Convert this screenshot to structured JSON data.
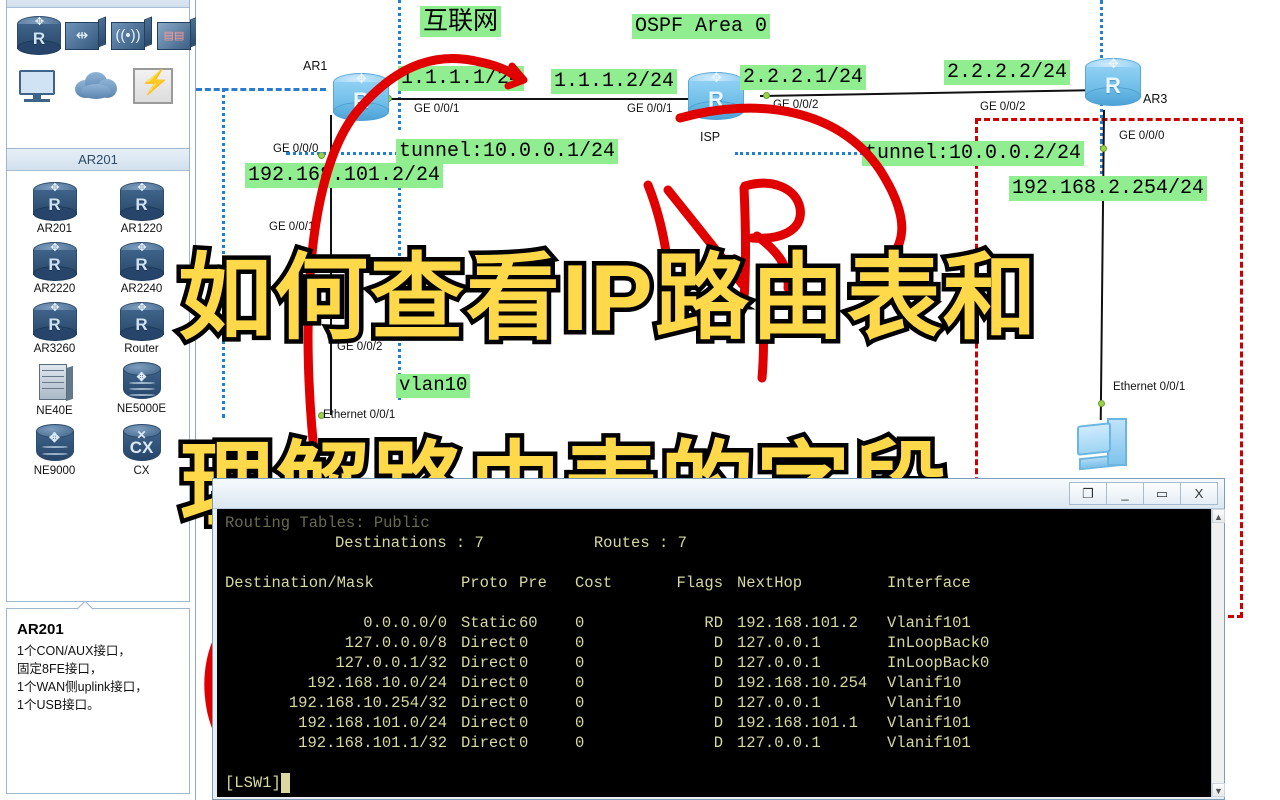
{
  "palette": {
    "top_group": {
      "icons": [
        {
          "name": "router-icon",
          "glyph": "R"
        },
        {
          "name": "switch-icon",
          "glyph": "⇄"
        },
        {
          "name": "wireless-ac-icon",
          "glyph": "((•))"
        },
        {
          "name": "firewall-icon",
          "glyph": "▦"
        },
        {
          "name": "pc-icon",
          "glyph": ""
        },
        {
          "name": "cloud-icon",
          "glyph": ""
        },
        {
          "name": "frame-relay-icon",
          "glyph": "⚡"
        }
      ]
    },
    "selected_group_title": "AR201",
    "devices": [
      {
        "label": "AR201",
        "type": "router"
      },
      {
        "label": "AR1220",
        "type": "router"
      },
      {
        "label": "AR2220",
        "type": "router"
      },
      {
        "label": "AR2240",
        "type": "router"
      },
      {
        "label": "AR3260",
        "type": "router"
      },
      {
        "label": "Router",
        "type": "router"
      },
      {
        "label": "NE40E",
        "type": "chassis"
      },
      {
        "label": "NE5000E",
        "type": "cylinder"
      },
      {
        "label": "NE9000",
        "type": "cylinder"
      },
      {
        "label": "CX",
        "type": "cx"
      }
    ],
    "info": {
      "title": "AR201",
      "lines": [
        "1个CON/AUX接口，",
        "固定8FE接口，",
        "1个WAN侧uplink接口，",
        "1个USB接口。"
      ]
    }
  },
  "topology": {
    "nodes": [
      {
        "name": "AR1",
        "label": "AR1"
      },
      {
        "name": "ISP",
        "label": "ISP"
      },
      {
        "name": "AR3",
        "label": "AR3"
      }
    ],
    "green_labels": [
      {
        "name": "internet-label",
        "text": "互联网"
      },
      {
        "name": "ospf-area-label",
        "text": "OSPF Area 0"
      },
      {
        "name": "ip-1-1-1-1",
        "text": "1.1.1.1/24"
      },
      {
        "name": "ip-1-1-1-2",
        "text": "1.1.1.2/24"
      },
      {
        "name": "ip-2-2-2-1",
        "text": "2.2.2.1/24"
      },
      {
        "name": "ip-2-2-2-2",
        "text": "2.2.2.2/24"
      },
      {
        "name": "tunnel-left",
        "text": "tunnel:10.0.0.1/24"
      },
      {
        "name": "tunnel-right",
        "text": "tunnel:10.0.0.2/24"
      },
      {
        "name": "ip-192-168-101-2",
        "text": "192.168.101.2/24"
      },
      {
        "name": "ip-192-168-2-254",
        "text": "192.168.2.254/24"
      },
      {
        "name": "vlan10-label",
        "text": "vlan10"
      }
    ],
    "interface_labels": [
      {
        "name": "if-ar1-ge001",
        "text": "GE 0/0/1"
      },
      {
        "name": "if-ar1-ge000",
        "text": "GE 0/0/0"
      },
      {
        "name": "if-isp-ge001",
        "text": "GE 0/0/1"
      },
      {
        "name": "if-isp-ge002",
        "text": "GE 0/0/2"
      },
      {
        "name": "if-ar3-ge002",
        "text": "GE 0/0/2"
      },
      {
        "name": "if-ar3-ge000",
        "text": "GE 0/0/0"
      },
      {
        "name": "if-sw-ge001",
        "text": "GE 0/0/1"
      },
      {
        "name": "if-sw-ge002",
        "text": "GE 0/0/2"
      },
      {
        "name": "if-sw-eth001",
        "text": "Ethernet 0/0/1"
      },
      {
        "name": "if-pc-eth001",
        "text": "Ethernet 0/0/1"
      }
    ]
  },
  "overlay_title": {
    "line1": "如何查看IP路由表和",
    "line2": "理解路由表的字段",
    "fill_color": "#ffd94a",
    "stroke_color": "#000000"
  },
  "terminal": {
    "titlebar_buttons": [
      {
        "name": "restore-button",
        "label": "❐"
      },
      {
        "name": "minimize-button",
        "label": "_"
      },
      {
        "name": "maximize-button",
        "label": "▭"
      },
      {
        "name": "close-button",
        "label": "X"
      }
    ],
    "summary": {
      "destinations_label": "Destinations",
      "destinations_value": "7",
      "routes_label": "Routes",
      "routes_value": "7"
    },
    "headers": {
      "destination": "Destination/Mask",
      "proto": "Proto",
      "pre": "Pre",
      "cost": "Cost",
      "flags": "Flags",
      "nexthop": "NextHop",
      "interface": "Interface"
    },
    "routes": [
      {
        "dest": "0.0.0.0/0",
        "proto": "Static",
        "pre": "60",
        "cost": "0",
        "flags": "RD",
        "nexthop": "192.168.101.2",
        "interface": "Vlanif101"
      },
      {
        "dest": "127.0.0.0/8",
        "proto": "Direct",
        "pre": "0",
        "cost": "0",
        "flags": "D",
        "nexthop": "127.0.0.1",
        "interface": "InLoopBack0"
      },
      {
        "dest": "127.0.0.1/32",
        "proto": "Direct",
        "pre": "0",
        "cost": "0",
        "flags": "D",
        "nexthop": "127.0.0.1",
        "interface": "InLoopBack0"
      },
      {
        "dest": "192.168.10.0/24",
        "proto": "Direct",
        "pre": "0",
        "cost": "0",
        "flags": "D",
        "nexthop": "192.168.10.254",
        "interface": "Vlanif10"
      },
      {
        "dest": "192.168.10.254/32",
        "proto": "Direct",
        "pre": "0",
        "cost": "0",
        "flags": "D",
        "nexthop": "127.0.0.1",
        "interface": "Vlanif10"
      },
      {
        "dest": "192.168.101.0/24",
        "proto": "Direct",
        "pre": "0",
        "cost": "0",
        "flags": "D",
        "nexthop": "192.168.101.1",
        "interface": "Vlanif101"
      },
      {
        "dest": "192.168.101.1/32",
        "proto": "Direct",
        "pre": "0",
        "cost": "0",
        "flags": "D",
        "nexthop": "127.0.0.1",
        "interface": "Vlanif101"
      }
    ],
    "prompt": "[LSW1]",
    "scroll_up": "▲",
    "scroll_down": "▼"
  },
  "colors": {
    "highlight_green": "#90ee90",
    "annotation_red": "#e00000",
    "title_yellow": "#ffd94a",
    "terminal_bg": "#000000",
    "terminal_fg": "#d8d8a0",
    "link_blue": "#1f7fd6"
  }
}
